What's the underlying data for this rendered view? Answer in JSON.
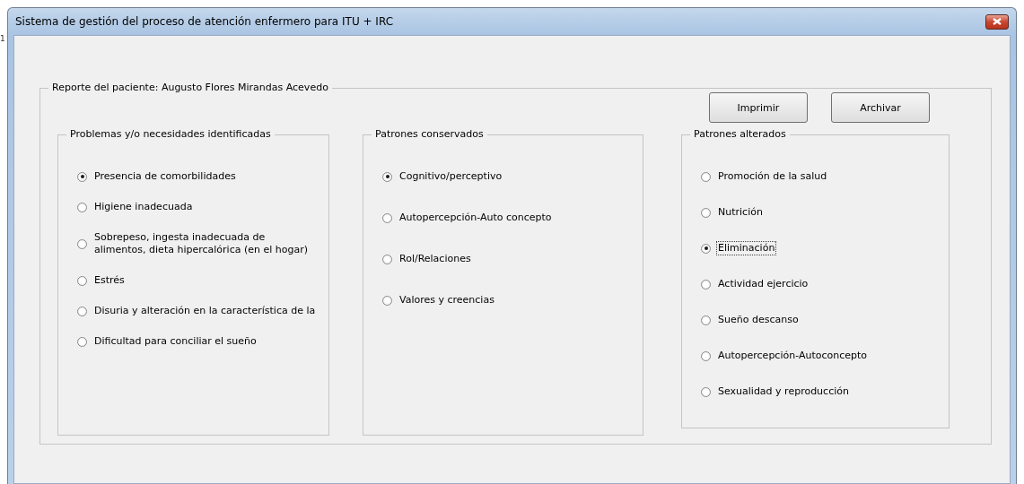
{
  "background_fragment": "1",
  "window": {
    "title": "Sistema de gestión del proceso de atención enfermero para ITU + IRC"
  },
  "report": {
    "title": "Reporte del paciente: Augusto Flores Mirandas Acevedo",
    "buttons": [
      "Imprimir",
      "Archivar"
    ],
    "groups": [
      {
        "title": "Problemas y/o necesidades identificadas",
        "options": [
          {
            "label": "Presencia de comorbilidades",
            "selected": true,
            "focused": false
          },
          {
            "label": "Higiene inadecuada",
            "selected": false,
            "focused": false
          },
          {
            "label": "Sobrepeso, ingesta inadecuada de alimentos, dieta hipercalórica (en el hogar)",
            "selected": false,
            "focused": false
          },
          {
            "label": "Estrés",
            "selected": false,
            "focused": false
          },
          {
            "label": "Disuria y alteración en la característica de la",
            "selected": false,
            "focused": false
          },
          {
            "label": "Dificultad para conciliar el sueño",
            "selected": false,
            "focused": false
          }
        ]
      },
      {
        "title": "Patrones conservados",
        "options": [
          {
            "label": "Cognitivo/perceptivo",
            "selected": true,
            "focused": false
          },
          {
            "label": "Autopercepción-Auto concepto",
            "selected": false,
            "focused": false
          },
          {
            "label": "Rol/Relaciones",
            "selected": false,
            "focused": false
          },
          {
            "label": "Valores y creencias",
            "selected": false,
            "focused": false
          }
        ]
      },
      {
        "title": "Patrones alterados",
        "options": [
          {
            "label": "Promoción de la salud",
            "selected": false,
            "focused": false
          },
          {
            "label": "Nutrición",
            "selected": false,
            "focused": false
          },
          {
            "label": "Eliminación",
            "selected": true,
            "focused": true
          },
          {
            "label": "Actividad ejercicio",
            "selected": false,
            "focused": false
          },
          {
            "label": "Sueño descanso",
            "selected": false,
            "focused": false
          },
          {
            "label": "Autopercepción-Autoconcepto",
            "selected": false,
            "focused": false
          },
          {
            "label": "Sexualidad y reproducción",
            "selected": false,
            "focused": false
          }
        ]
      }
    ]
  }
}
